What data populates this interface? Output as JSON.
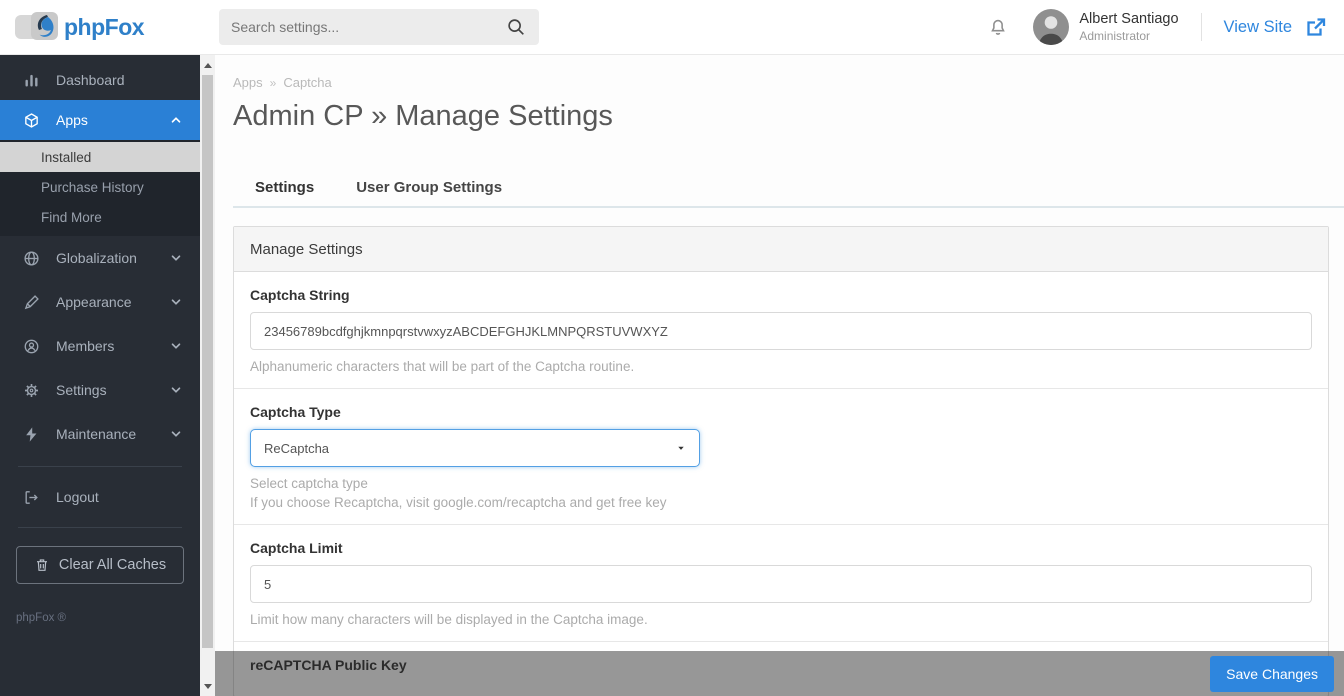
{
  "colors": {
    "accent": "#2e86de",
    "sidebar_bg": "#282d35",
    "active_item_bg": "#2a80d6"
  },
  "header": {
    "brand": "phpFox",
    "search_placeholder": "Search settings...",
    "user_name": "Albert Santiago",
    "user_role": "Administrator",
    "view_site_label": "View Site"
  },
  "sidebar": {
    "items": [
      {
        "label": "Dashboard",
        "icon": "bar-chart-icon",
        "active": false
      },
      {
        "label": "Apps",
        "icon": "cube-icon",
        "active": true
      },
      {
        "label": "Globalization",
        "icon": "globe-icon",
        "active": false
      },
      {
        "label": "Appearance",
        "icon": "pen-icon",
        "active": false
      },
      {
        "label": "Members",
        "icon": "member-icon",
        "active": false
      },
      {
        "label": "Settings",
        "icon": "gear-icon",
        "active": false
      },
      {
        "label": "Maintenance",
        "icon": "bolt-icon",
        "active": false
      },
      {
        "label": "Logout",
        "icon": "logout-icon",
        "active": false
      }
    ],
    "apps_submenu": [
      {
        "label": "Installed",
        "active": true
      },
      {
        "label": "Purchase History",
        "active": false
      },
      {
        "label": "Find More",
        "active": false
      }
    ],
    "clear_caches_label": "Clear All Caches",
    "copyright": "phpFox ®"
  },
  "main": {
    "breadcrumb": {
      "section": "Apps",
      "separator": "»",
      "page": "Captcha"
    },
    "title": "Admin CP » Manage Settings",
    "tabs": [
      {
        "label": "Settings",
        "active": true
      },
      {
        "label": "User Group Settings",
        "active": false
      }
    ],
    "panel": {
      "title": "Manage Settings",
      "fields": [
        {
          "label": "Captcha String",
          "value": "23456789bcdfghjkmnpqrstvwxyzABCDEFGHJKLMNPQRSTUVWXYZ",
          "help": "Alphanumeric characters that will be part of the Captcha routine."
        },
        {
          "label": "Captcha Type",
          "value": "ReCaptcha",
          "help": "Select captcha type",
          "help2": "If you choose Recaptcha, visit google.com/recaptcha and get free key"
        },
        {
          "label": "Captcha Limit",
          "value": "5",
          "help": "Limit how many characters will be displayed in the Captcha image."
        },
        {
          "label": "reCAPTCHA Public Key"
        }
      ]
    }
  },
  "footer": {
    "save_label": "Save Changes"
  }
}
